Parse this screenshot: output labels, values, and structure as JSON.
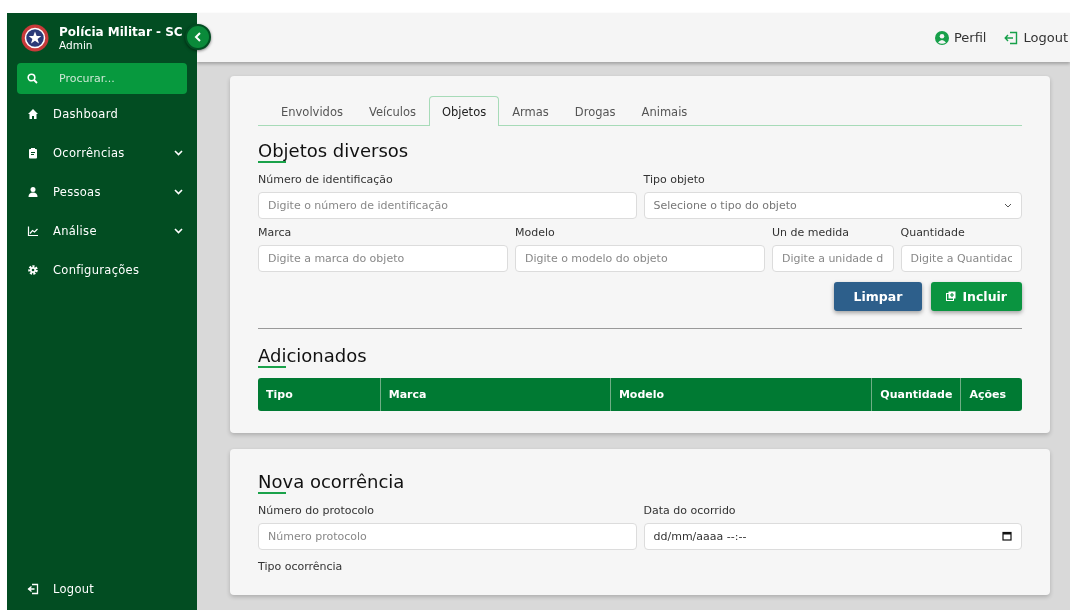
{
  "sidebar": {
    "title": "Polícia Militar - SC",
    "role": "Admin",
    "search": {
      "placeholder": "Procurar..."
    },
    "items": [
      {
        "label": "Dashboard",
        "expandable": false
      },
      {
        "label": "Ocorrências",
        "expandable": true
      },
      {
        "label": "Pessoas",
        "expandable": true
      },
      {
        "label": "Análise",
        "expandable": true
      },
      {
        "label": "Configurações",
        "expandable": false
      }
    ],
    "logout": "Logout"
  },
  "header": {
    "profile": "Perfil",
    "logout": "Logout"
  },
  "tabs": [
    {
      "label": "Envolvidos",
      "selected": false
    },
    {
      "label": "Veículos",
      "selected": false
    },
    {
      "label": "Objetos",
      "selected": true
    },
    {
      "label": "Armas",
      "selected": false
    },
    {
      "label": "Drogas",
      "selected": false
    },
    {
      "label": "Animais",
      "selected": false
    }
  ],
  "form": {
    "title": "Objetos diversos",
    "rows": [
      [
        {
          "label": "Número de identificação",
          "placeholder": "Digite o número de identificação",
          "kind": "input"
        },
        {
          "label": "Tipo objeto",
          "placeholder": "Selecione o tipo do objeto",
          "kind": "select"
        }
      ],
      [
        {
          "label": "Marca",
          "placeholder": "Digite a marca do objeto",
          "kind": "input"
        },
        {
          "label": "Modelo",
          "placeholder": "Digite o modelo do objeto",
          "kind": "input"
        },
        {
          "label": "Un de medida",
          "placeholder": "Digite a unidade d",
          "kind": "input"
        },
        {
          "label": "Quantidade",
          "placeholder": "Digite a Quantidac",
          "kind": "input"
        }
      ]
    ],
    "buttons": [
      {
        "label": "Limpar",
        "kind": "secondary"
      },
      {
        "label": "Incluir",
        "kind": "primary"
      }
    ]
  },
  "added": {
    "title": "Adicionados",
    "columns": [
      "Tipo",
      "Marca",
      "Modelo",
      "Quantidade",
      "Ações"
    ]
  },
  "new_occurrence": {
    "title": "Nova ocorrência",
    "fields": [
      {
        "label": "Número do protocolo",
        "placeholder": "Número protocolo",
        "kind": "input"
      },
      {
        "label": "Data do ocorrido",
        "value": "dd/mm/aaaa --:--",
        "kind": "datetime"
      }
    ],
    "next_label": "Tipo ocorrência"
  }
}
